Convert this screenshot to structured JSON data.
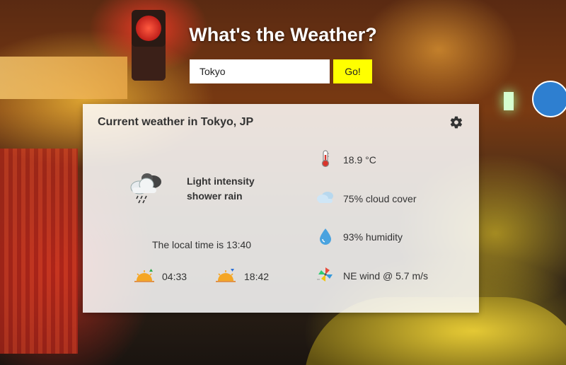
{
  "app": {
    "title": "What's the Weather?"
  },
  "search": {
    "value": "Tokyo",
    "button_label": "Go!"
  },
  "weather": {
    "heading": "Current weather in Tokyo, JP",
    "condition_line1": "Light intensity",
    "condition_line2": "shower rain",
    "local_time": "The local time is 13:40",
    "sunrise": "04:33",
    "sunset": "18:42",
    "temperature": "18.9 °C",
    "cloud_cover": "75% cloud cover",
    "humidity": "93% humidity",
    "wind": "NE wind @ 5.7 m/s"
  },
  "icons": {
    "settings": "gear-icon",
    "condition": "rain-cloud-icon",
    "sunrise": "sunrise-icon",
    "sunset": "sunset-icon",
    "temperature": "thermometer-icon",
    "clouds": "cloud-icon",
    "humidity": "droplet-icon",
    "wind": "pinwheel-icon"
  },
  "colors": {
    "accent": "#ffff00",
    "panel": "rgba(255,255,255,0.85)"
  }
}
